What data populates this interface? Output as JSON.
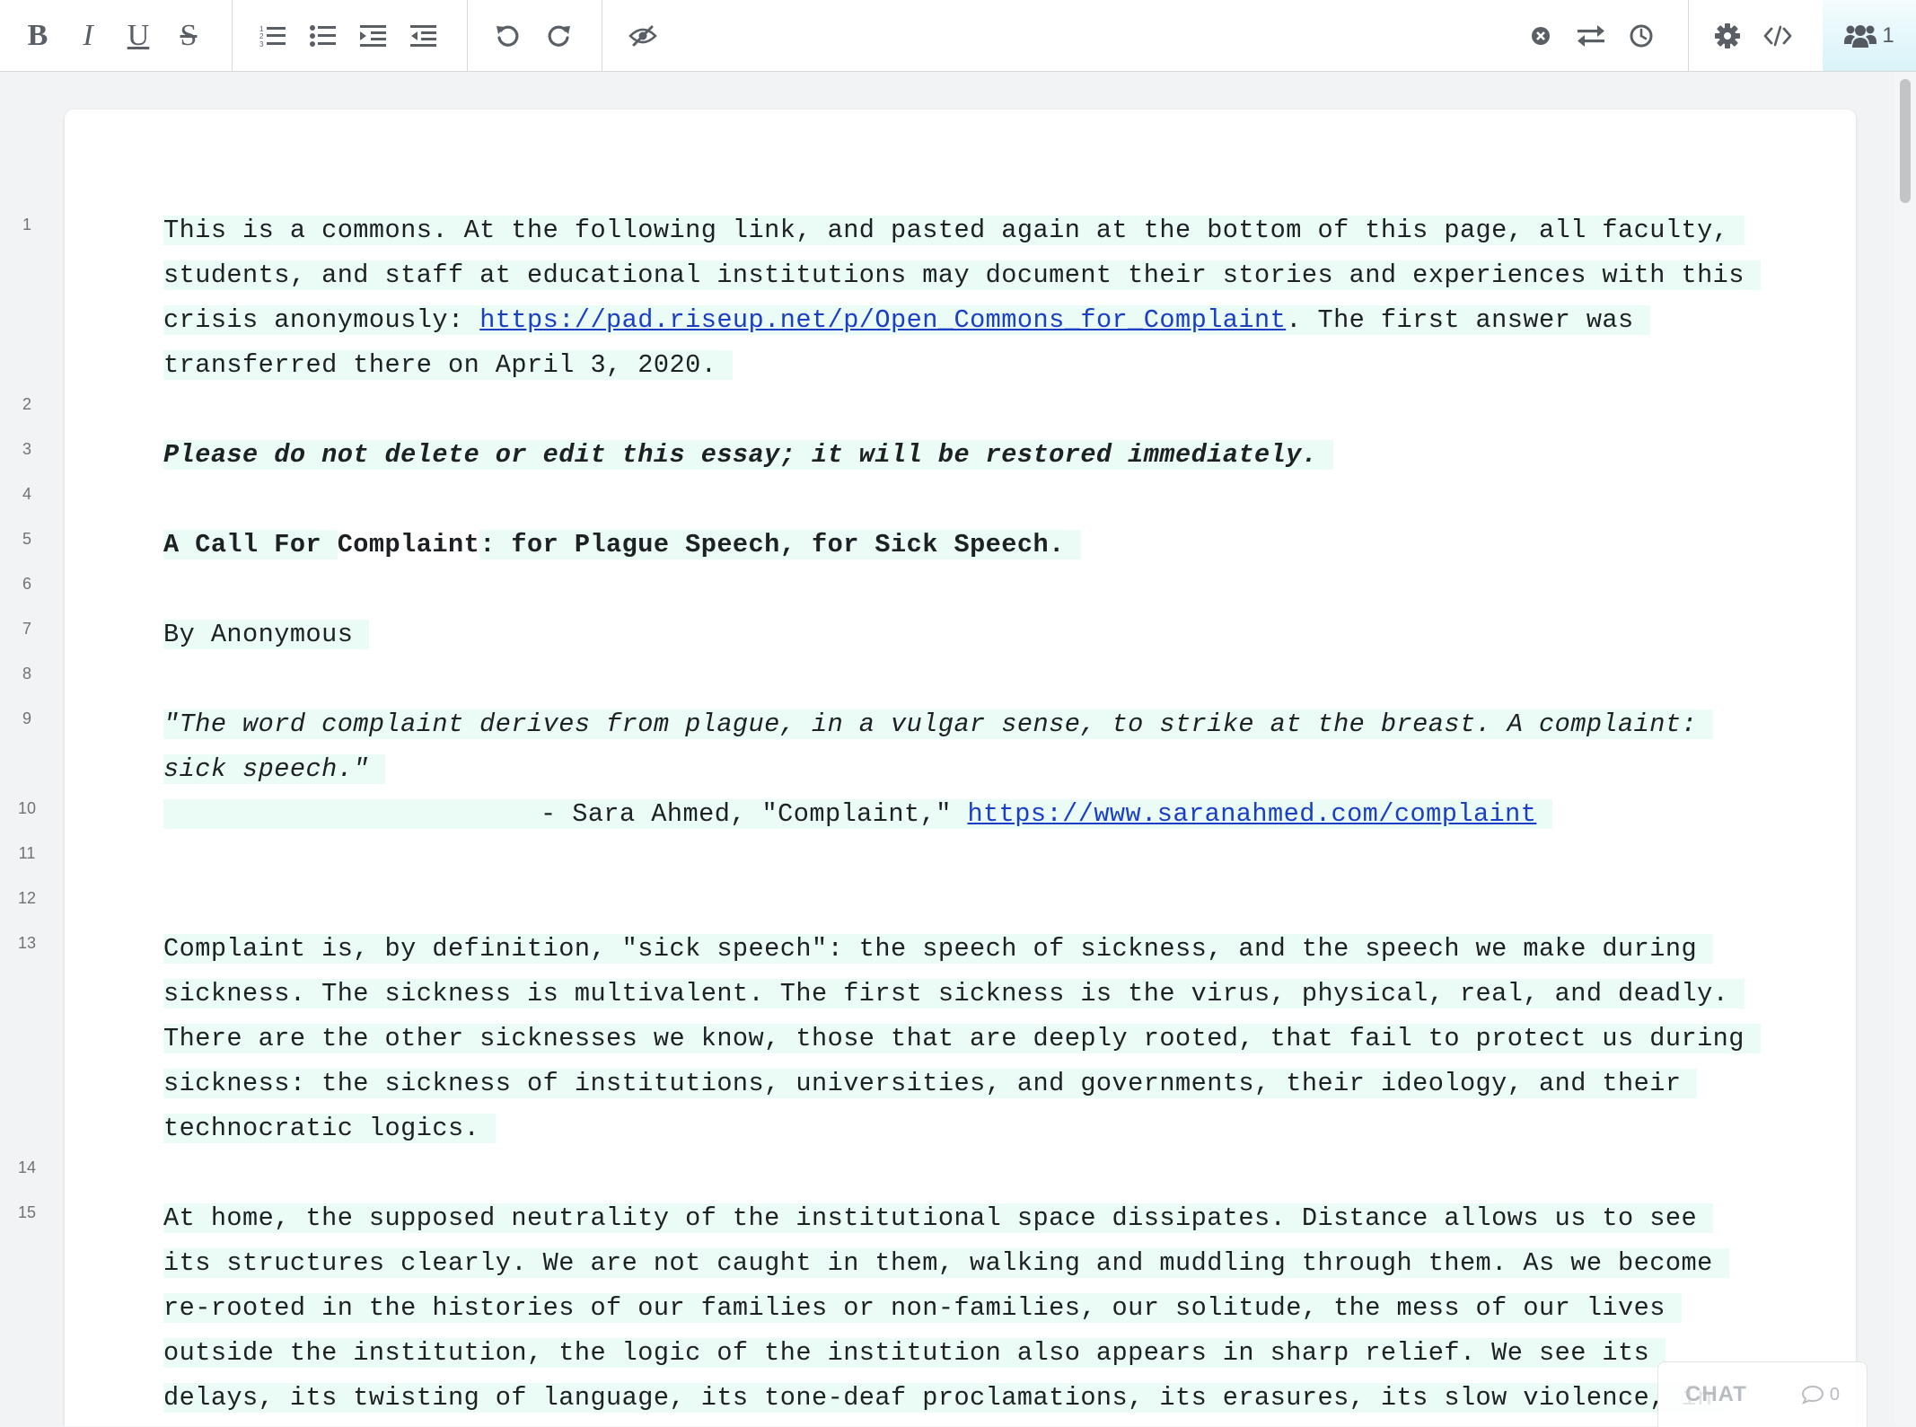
{
  "toolbar": {
    "left_buttons": [
      {
        "name": "bold-button",
        "icon": "bold-icon",
        "glyph": "B"
      },
      {
        "name": "italic-button",
        "icon": "italic-icon",
        "glyph": "I"
      },
      {
        "name": "underline-button",
        "icon": "underline-icon",
        "glyph": "U"
      },
      {
        "name": "strikethrough-button",
        "icon": "strikethrough-icon",
        "glyph": "S"
      }
    ],
    "list_buttons": [
      "ordered-list-icon",
      "unordered-list-icon",
      "indent-icon",
      "outdent-icon"
    ],
    "history_buttons": [
      "undo-icon",
      "redo-icon"
    ],
    "authorship_button": "eye-slash-icon",
    "right_buttons": [
      "clear-authorship-icon",
      "import-export-icon",
      "timeslider-clock-icon"
    ],
    "settings_buttons": [
      "gear-icon",
      "embed-code-icon"
    ],
    "users": {
      "icon": "users-icon",
      "count": "1"
    }
  },
  "line_numbers": [
    "1",
    "2",
    "3",
    "4",
    "5",
    "6",
    "7",
    "8",
    "9",
    "10",
    "11",
    "12",
    "13",
    "14",
    "15"
  ],
  "document": {
    "p1_before_link": "This is a commons. At the following link, and pasted again at the bottom of this page, all faculty, students, and staff at educational institutions may document their stories and experiences with this crisis anonymously: ",
    "p1_link": "https://pad.riseup.net/p/Open_Commons_for_Complaint",
    "p1_after_link": ". The first answer was transferred there on April 3, 2020.",
    "p3": "Please do not delete or edit this essay; it will be restored immediately.",
    "p5_part1": "A Call For ",
    "p5_part2": "Complaint",
    "p5_part3": ": for Plague Speech, for Sick Speech.",
    "p7": "By Anonymous",
    "p9": "\"The word complaint derives from plague, in a vulgar sense, to strike at the breast. A complaint: sick speech.\"",
    "p10_prefix": "- Sara Ahmed, \"Complaint,\" ",
    "p10_link": "https://www.saranahmed.com/complaint",
    "p13": "Complaint is, by definition, \"sick speech\": the speech of sickness, and the speech we make during sickness. The sickness is multivalent. The first sickness is the virus, physical, real, and deadly. There are the other sicknesses we know, those that are deeply rooted, that fail to protect us during sickness: the sickness of institutions, universities, and governments, their ideology, and their technocratic logics.",
    "p15": "At home, the supposed neutrality of the institutional space dissipates. Distance allows us to see its structures clearly. We are not caught in them, walking and muddling through them. As we become re-rooted in the histories of our families or non-families, our solitude, the mess of our lives outside the institution, the logic of the institution also appears in sharp relief. We see its delays, its twisting of language, its tone-deaf proclamations, its erasures, its slow violence, in"
  },
  "chat": {
    "label": "CHAT",
    "count": "0"
  },
  "colors": {
    "author_highlight": "#ebfbf5",
    "link": "#1a3fc4",
    "users_button": "#d9f3f8"
  }
}
